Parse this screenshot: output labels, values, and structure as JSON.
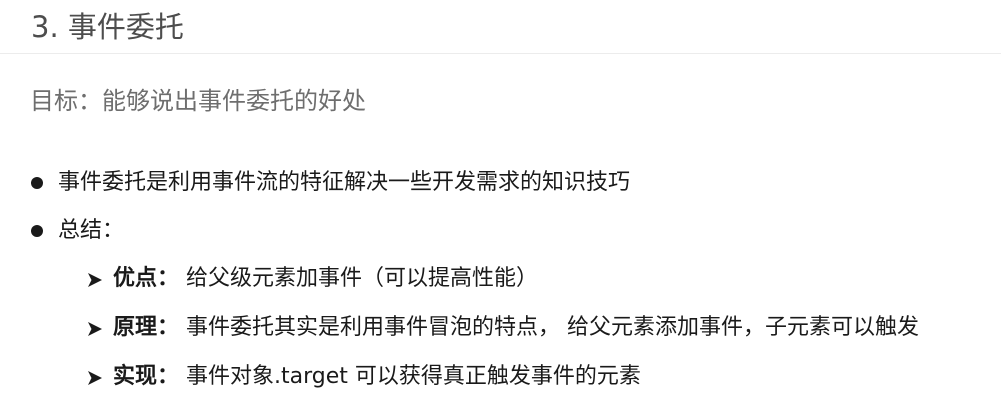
{
  "header": {
    "title": "3. 事件委托"
  },
  "goal": "目标：能够说出事件委托的好处",
  "bullets": [
    {
      "text": "事件委托是利用事件流的特征解决一些开发需求的知识技巧"
    },
    {
      "text": "总结："
    }
  ],
  "sub_items": [
    {
      "label": "优点：",
      "text": "给父级元素加事件（可以提高性能）"
    },
    {
      "label": "原理：",
      "text": "事件委托其实是利用事件冒泡的特点， 给父元素添加事件，子元素可以触发"
    },
    {
      "label": "实现：",
      "text": "事件对象.target 可以获得真正触发事件的元素"
    }
  ],
  "icons": {
    "bullet": "filled-circle-bullet-icon",
    "sub_bullet": "arrowhead-bullet-icon"
  },
  "colors": {
    "title": "#4d4d4d",
    "goal": "#6e6e6e",
    "body_text": "#1a1a1a",
    "divider": "#ececec"
  }
}
